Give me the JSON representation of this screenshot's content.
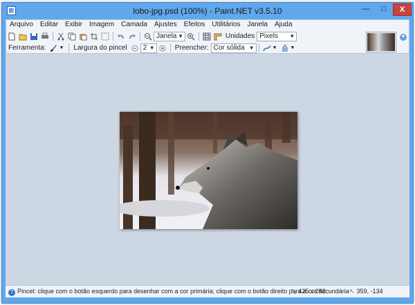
{
  "window": {
    "title": "lobo-jpg.psd (100%) - Paint.NET v3.5.10",
    "min_glyph": "—",
    "max_glyph": "□",
    "close_glyph": "X"
  },
  "menu": [
    "Arquivo",
    "Editar",
    "Exibir",
    "Imagem",
    "Camada",
    "Ajustes",
    "Efeitos",
    "Utilitários",
    "Janela",
    "Ajuda"
  ],
  "toolbar1": {
    "zoom_value": "Janela",
    "units_label": "Unidades",
    "units_value": "Pixels"
  },
  "toolbar2": {
    "tool_label": "Ferramenta:",
    "brush_width_label": "Largura do pincel",
    "brush_width_value": "2",
    "fill_label": "Preencher:",
    "fill_value": "Cor sólida"
  },
  "status": {
    "help_glyph": "?",
    "help_text": "Pincel: clique com o botão esquerdo para desenhar com a cor primária; clique com o botão direito para a cor secundária",
    "image_size": "425 x 282",
    "cursor_pos": "359, -134"
  },
  "colors": {
    "window_frame": "#61a7ec",
    "canvas_background": "#cdd7e4",
    "close_button": "#c7453b"
  }
}
